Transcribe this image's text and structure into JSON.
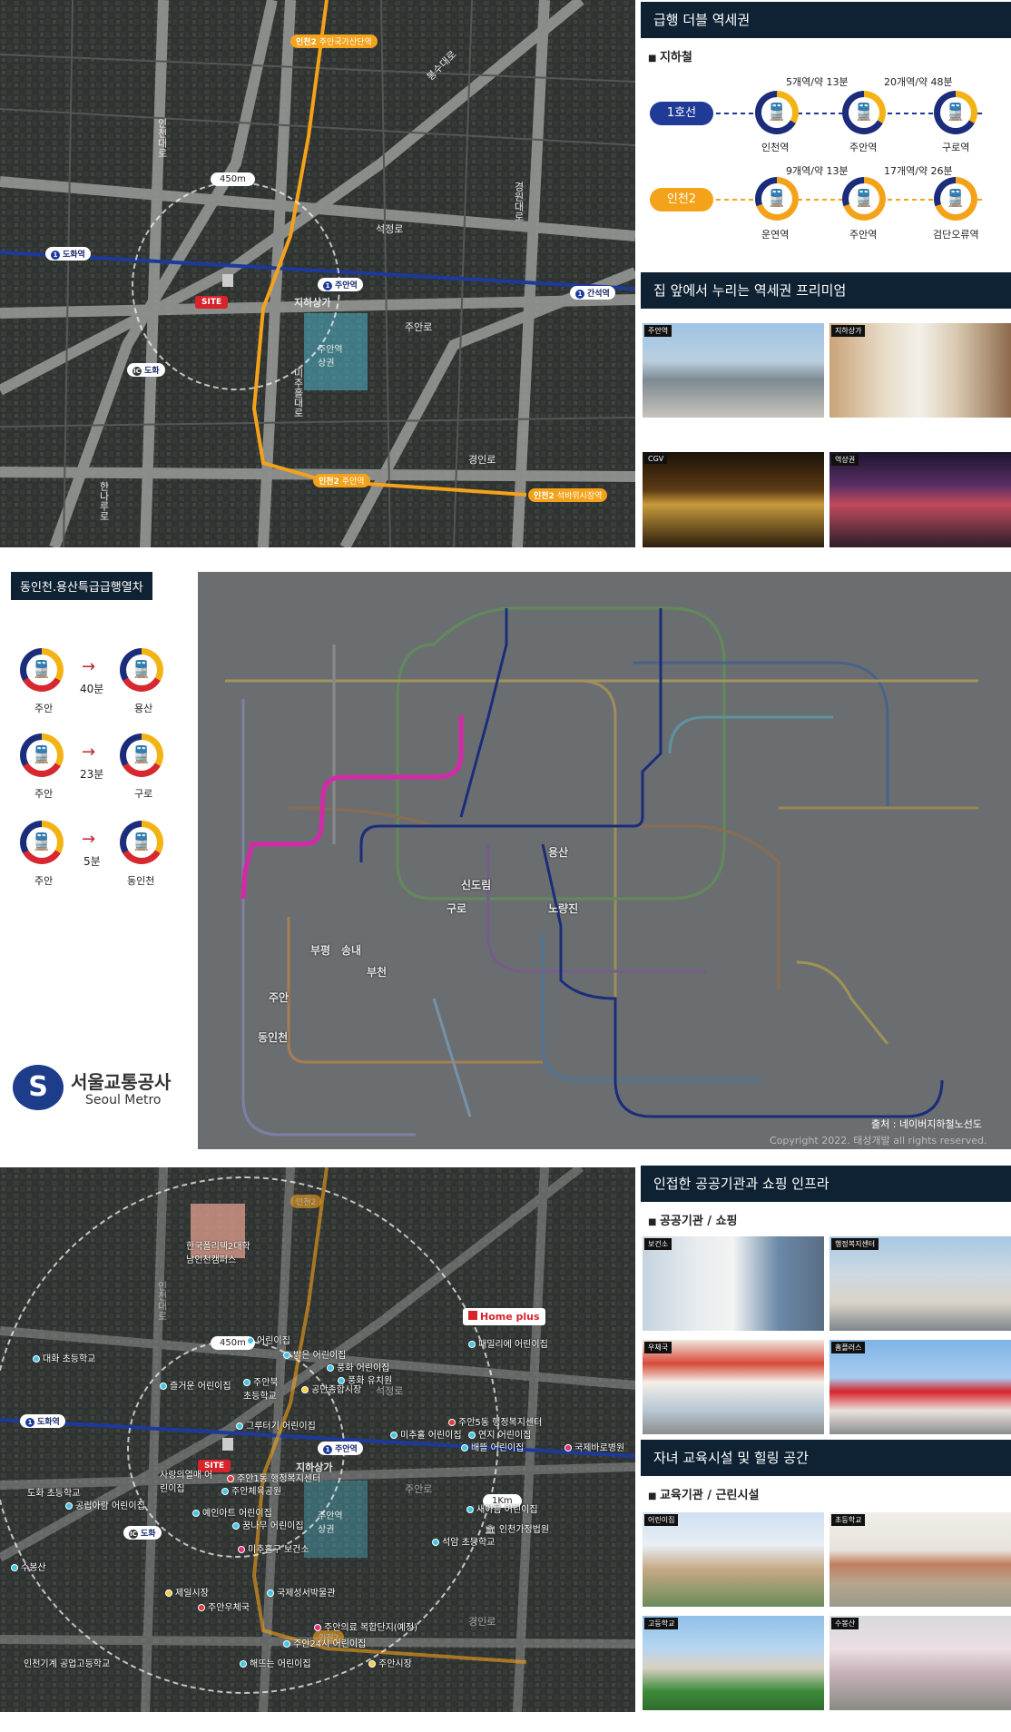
{
  "top_map": {
    "radius_label": "450m",
    "site_label": "SITE",
    "roads": [
      "석정로",
      "주안로",
      "경인로",
      "인천대로",
      "경원대로",
      "한나루로",
      "미추홀대로",
      "봉수대로"
    ],
    "stations": {
      "juan": "주안역",
      "dohwa": "도화역",
      "ganseok": "간석역",
      "underground_mall": "지하상가",
      "commercial": "주안역 상권",
      "ic": "도화",
      "line2_north": "주안국가산단역",
      "line2_south": "주안역",
      "line2_se": "석바위시장역",
      "line2_n_badge": "인천2",
      "line2_s_badge": "인천2",
      "line2_se_badge": "인천2"
    }
  },
  "subway_panel": {
    "title": "급행 더블 역세권",
    "sub": "지하철",
    "line1": {
      "label": "1호선",
      "stations": [
        "인천역",
        "주안역",
        "구로역"
      ],
      "intervals": [
        "5개역/약 13분",
        "20개역/약 48분"
      ]
    },
    "line2": {
      "label": "인천2",
      "stations": [
        "운연역",
        "주안역",
        "검단오류역"
      ],
      "intervals": [
        "9개역/약 13분",
        "17개역/약 26분"
      ]
    }
  },
  "premium_panel": {
    "title": "집 앞에서 누리는 역세권 프리미엄",
    "photos": [
      "주안역",
      "지하상가",
      "CGV",
      "역상권"
    ]
  },
  "express": {
    "title": "동인천.용산특급급행열차",
    "routes": [
      {
        "from": "주안",
        "time": "40분",
        "to": "용산"
      },
      {
        "from": "주안",
        "time": "23분",
        "to": "구로"
      },
      {
        "from": "주안",
        "time": "5분",
        "to": "동인천"
      }
    ],
    "metro_name": "서울교통공사",
    "metro_en": "Seoul Metro"
  },
  "subway_map": {
    "highlight_stations": [
      "용산",
      "신도림",
      "구로",
      "노량진",
      "부평",
      "송내",
      "부천",
      "주안",
      "동인천"
    ],
    "source": "출처 : 네이버지하철노선도",
    "copyright": "Copyright 2022. 태성개발 all rights reserved."
  },
  "bottom_map": {
    "radius_450": "450m",
    "radius_1k": "1Km",
    "site_label": "SITE",
    "homeplus": "Home plus",
    "station_juan": "주안역",
    "station_dohwa": "도화역",
    "ic": "도화",
    "underground_mall": "지하상가",
    "commercial": "주안역 상권",
    "roads": [
      "석정로",
      "주안로",
      "경인로",
      "인천대로"
    ],
    "line2_badges": [
      "인천2",
      "인천2"
    ],
    "pois": [
      {
        "label": "한국폴리텍2대학 남인천캠퍼스",
        "type": "none"
      },
      {
        "label": "어린이집",
        "type": "school"
      },
      {
        "label": "밝은 어린이집",
        "type": "school"
      },
      {
        "label": "풍화 어린이집",
        "type": "school"
      },
      {
        "label": "풍화 유치원",
        "type": "school"
      },
      {
        "label": "대화 초등학교",
        "type": "school"
      },
      {
        "label": "즐거운 어린이집",
        "type": "school"
      },
      {
        "label": "주안북 초등학교",
        "type": "school"
      },
      {
        "label": "공단종합시장",
        "type": "yellow"
      },
      {
        "label": "패밀리에 어린이집",
        "type": "school"
      },
      {
        "label": "도화역",
        "type": "none"
      },
      {
        "label": "그루터기 어린이집",
        "type": "school"
      },
      {
        "label": "주안5동 행정복지센터",
        "type": "red"
      },
      {
        "label": "미추홀 어린이집",
        "type": "school"
      },
      {
        "label": "연지 어린이집",
        "type": "school"
      },
      {
        "label": "배뜰 어린이집",
        "type": "school"
      },
      {
        "label": "국제바로병원",
        "type": "none"
      },
      {
        "label": "사랑의열매 어린이집",
        "type": "school"
      },
      {
        "label": "주안1동 행정복지센터",
        "type": "red"
      },
      {
        "label": "주안체육공원",
        "type": "school"
      },
      {
        "label": "도화 초등학교",
        "type": "school"
      },
      {
        "label": "공립아람 어린이집",
        "type": "school"
      },
      {
        "label": "예인아트 어린이집",
        "type": "school"
      },
      {
        "label": "꿈나무 어린이집",
        "type": "school"
      },
      {
        "label": "새아름 어린이집",
        "type": "school"
      },
      {
        "label": "인천가정법원",
        "type": "none"
      },
      {
        "label": "석암 초등학교",
        "type": "school"
      },
      {
        "label": "미추홀구 보건소",
        "type": "pink"
      },
      {
        "label": "수봉산",
        "type": "school"
      },
      {
        "label": "제일시장",
        "type": "yellow"
      },
      {
        "label": "국제성서박물관",
        "type": "school"
      },
      {
        "label": "주안우체국",
        "type": "red"
      },
      {
        "label": "주안의료 복합단지(예정)",
        "type": "pink"
      },
      {
        "label": "주안24시 어린이집",
        "type": "school"
      },
      {
        "label": "인천기계 공업고등학교",
        "type": "school"
      },
      {
        "label": "해뜨는 어린이집",
        "type": "school"
      },
      {
        "label": "주안시장",
        "type": "yellow"
      }
    ]
  },
  "public_panel": {
    "title": "인접한 공공기관과 쇼핑 인프라",
    "sub": "공공기관 / 쇼핑",
    "photos": [
      "보건소",
      "행정복지센터",
      "우체국",
      "홈플러스"
    ]
  },
  "edu_panel": {
    "title": "자녀 교육시설 및 힐링 공간",
    "sub": "교육기관 / 근린시설",
    "photos": [
      "어린이집",
      "초등학교",
      "고등학교",
      "수봉산"
    ]
  }
}
